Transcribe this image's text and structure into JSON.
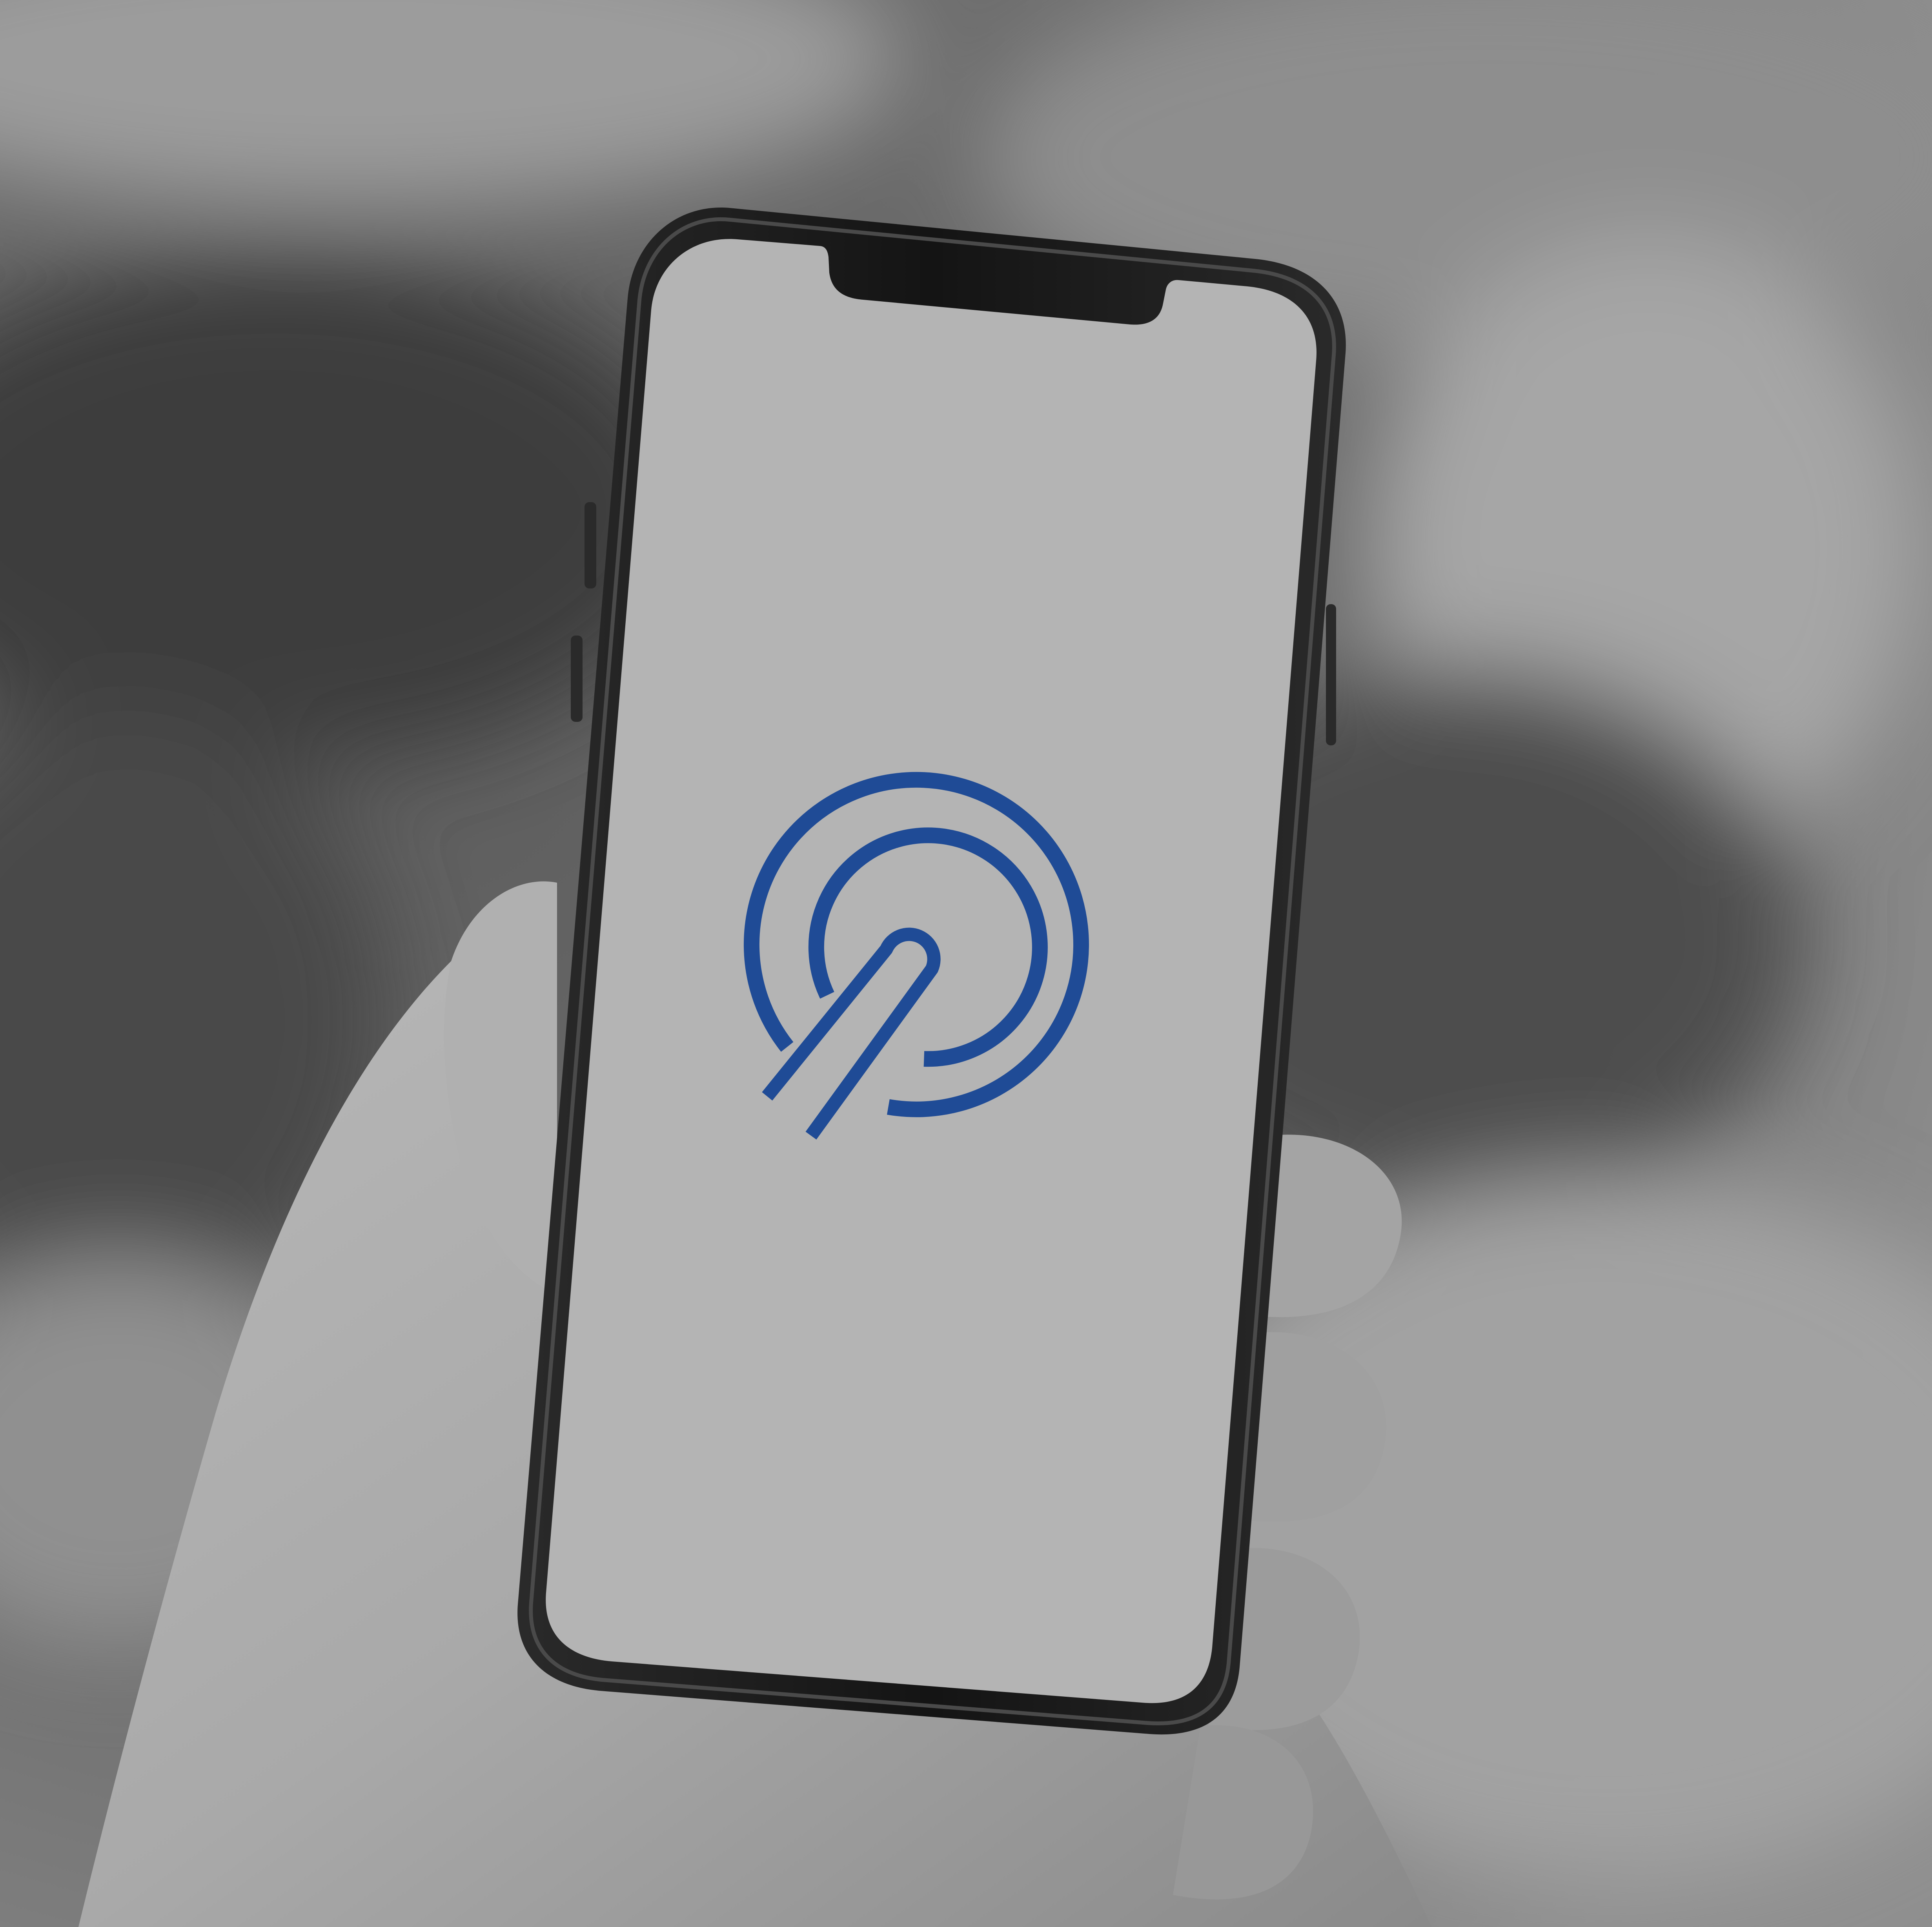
{
  "scene": {
    "description_free": true,
    "colors": {
      "background_dark": "#4a4a4a",
      "background_light": "#9a9a9a",
      "phone_frame": "#1b1b1b",
      "phone_rim": "#3a3a3a",
      "screen": "#b4b4b4",
      "skin_light": "#b5b5b5",
      "skin_shadow": "#7a7a7a",
      "logo_blue": "#1f4b96"
    },
    "icons": {
      "logo": "concentric-rings-with-diagonal-stroke-logo-icon"
    }
  }
}
